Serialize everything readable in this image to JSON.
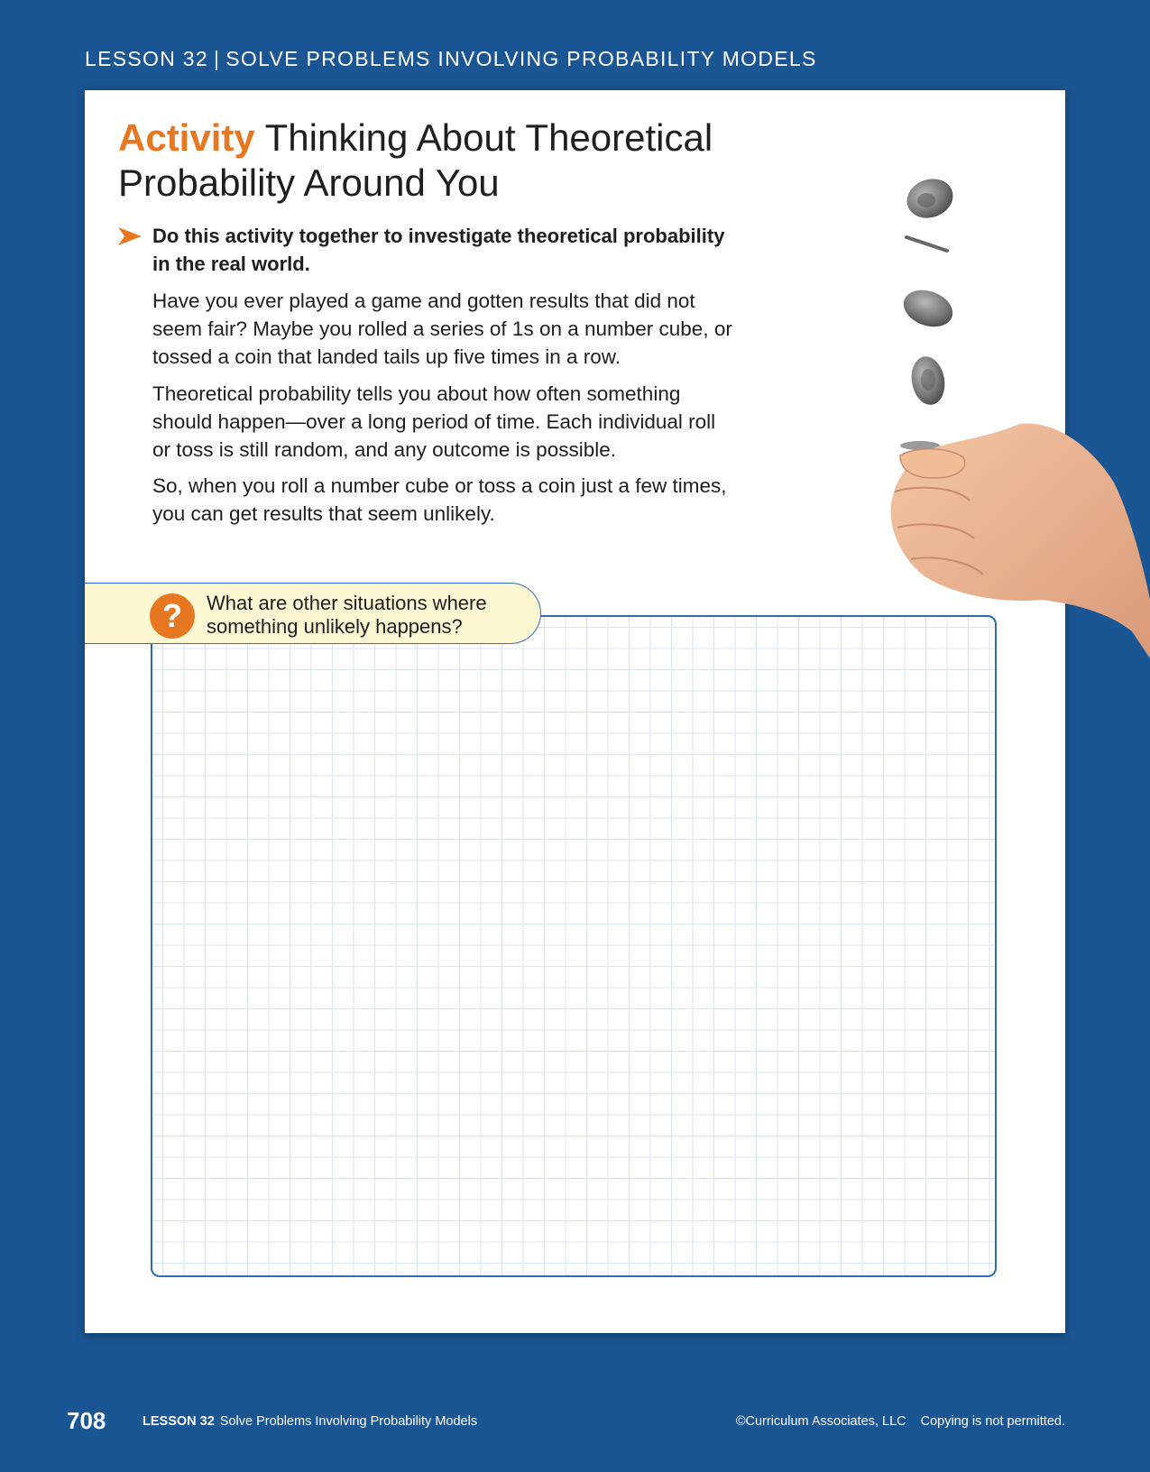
{
  "header": {
    "lesson": "LESSON 32",
    "separator": "|",
    "title": "SOLVE PROBLEMS INVOLVING PROBABILITY MODELS"
  },
  "activity": {
    "label": "Activity",
    "title_line1": "Thinking About Theoretical",
    "title_line2": "Probability Around You",
    "instruction": "Do this activity together to investigate theoretical probability in the real world.",
    "paragraphs": [
      "Have you ever played a game and gotten results that did not seem fair? Maybe you rolled a series of 1s on a number cube, or tossed a coin that landed tails up five times in a row.",
      "Theoretical probability tells you about how often something should happen—over a long period of time. Each individual roll or toss is still random, and any outcome is possible.",
      "So, when you roll a number cube or toss a coin just a few times, you can get results that seem unlikely."
    ]
  },
  "prompt": {
    "icon": "?",
    "text": "What are other situations where something unlikely happens?"
  },
  "footer": {
    "page_number": "708",
    "lesson": "LESSON 32",
    "lesson_title": "Solve Problems Involving Probability Models",
    "copyright": "©Curriculum Associates, LLC",
    "notice": "Copying is not permitted."
  },
  "colors": {
    "background": "#1b5694",
    "accent": "#e87722",
    "grid_border": "#2f6db3",
    "prompt_fill": "#fdf8d3"
  }
}
